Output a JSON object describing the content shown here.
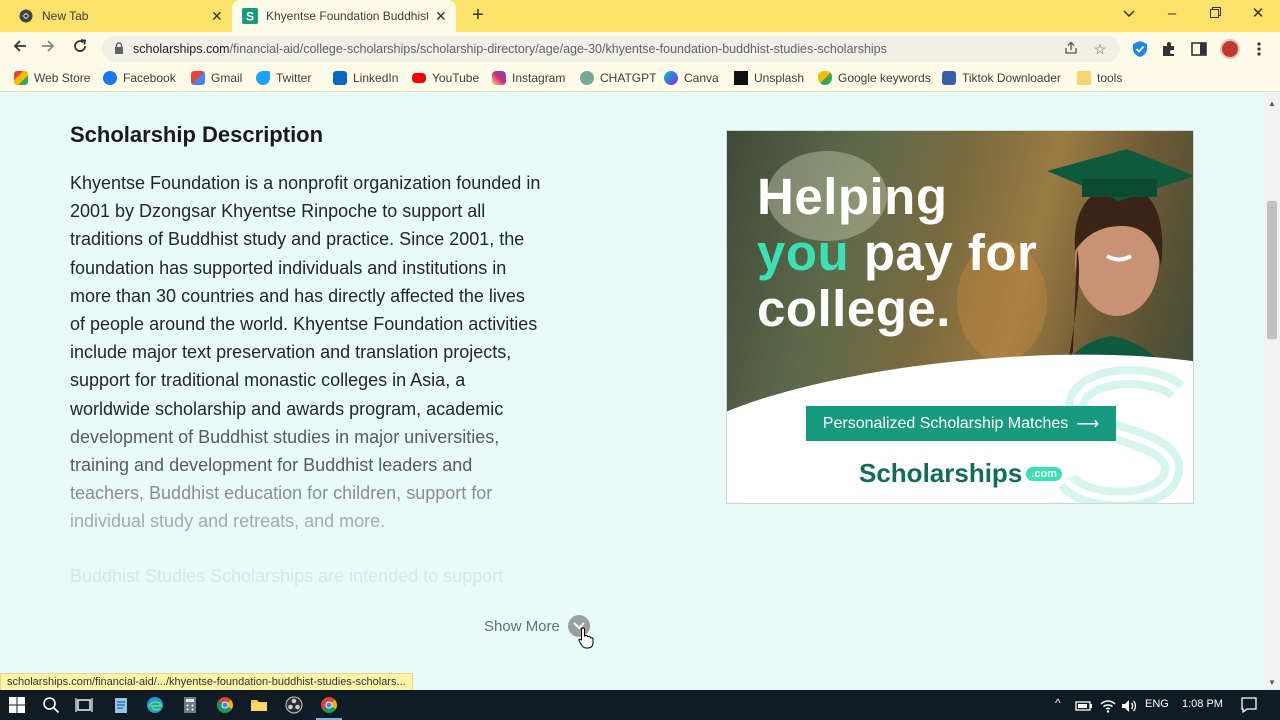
{
  "browser": {
    "tabs": [
      {
        "label": "New Tab",
        "active": false
      },
      {
        "label": "Khyentse Foundation Buddhist St",
        "active": true
      }
    ],
    "new_tab_symbol": "+",
    "url_domain": "scholarships.com",
    "url_path": "/financial-aid/college-scholarships/scholarship-directory/age/age-30/khyentse-foundation-buddhist-studies-scholarships",
    "bookmarks": [
      {
        "label": "Web Store",
        "icon": "webstore-icon",
        "color": "#e94235"
      },
      {
        "label": "Facebook",
        "icon": "facebook-icon",
        "color": "#1877f2"
      },
      {
        "label": "Gmail",
        "icon": "gmail-icon",
        "color": "#ea4335"
      },
      {
        "label": "Twitter",
        "icon": "twitter-icon",
        "color": "#1da1f2"
      },
      {
        "label": "LinkedIn",
        "icon": "linkedin-icon",
        "color": "#0a66c2"
      },
      {
        "label": "YouTube",
        "icon": "youtube-icon",
        "color": "#ff0000"
      },
      {
        "label": "Instagram",
        "icon": "instagram-icon",
        "color": "#d62976"
      },
      {
        "label": "CHATGPT",
        "icon": "chatgpt-icon",
        "color": "#74aa9c"
      },
      {
        "label": "Canva",
        "icon": "canva-icon",
        "color": "#7d2ae8"
      },
      {
        "label": "Unsplash",
        "icon": "unsplash-icon",
        "color": "#111111"
      },
      {
        "label": "Google keywords",
        "icon": "google-ads-icon",
        "color": "#34a853"
      },
      {
        "label": "Tiktok Downloader",
        "icon": "download-icon",
        "color": "#3a5fa8"
      },
      {
        "label": "tools",
        "icon": "folder-icon",
        "color": "#f5d76e"
      }
    ]
  },
  "page": {
    "heading": "Scholarship Description",
    "description_lines": [
      "Khyentse Foundation is a nonprofit organization founded in",
      "2001 by Dzongsar Khyentse Rinpoche to support all",
      "traditions of Buddhist study and practice. Since 2001, the",
      "foundation has supported individuals and institutions in",
      "more than 30 countries and has directly affected the lives",
      "of people around the world. Khyentse Foundation activities",
      "include major text preservation and translation projects,",
      "support for traditional monastic colleges in Asia, a",
      "worldwide scholarship and awards program, academic",
      "development of Buddhist studies in major universities,",
      "training and development for Buddhist leaders and",
      "teachers, Buddhist education for children, support for",
      "individual study and retreats, and more."
    ],
    "faded_tail": "Buddhist Studies Scholarships are intended to support",
    "show_more": "Show More"
  },
  "ad": {
    "headline_1": "Helping",
    "headline_2_accent": "you",
    "headline_2_rest": " pay for",
    "headline_3": "college.",
    "button": "Personalized Scholarship Matches",
    "button_arrow": "⟶",
    "brand": "Scholarships",
    "brand_suffix": ".com",
    "accent_color": "#3be0b5",
    "button_color": "#179a7f"
  },
  "status_link": "scholarships.com/financial-aid/.../khyentse-foundation-buddhist-studies-scholars...",
  "taskbar": {
    "language": "ENG",
    "time": "1:08 PM"
  }
}
